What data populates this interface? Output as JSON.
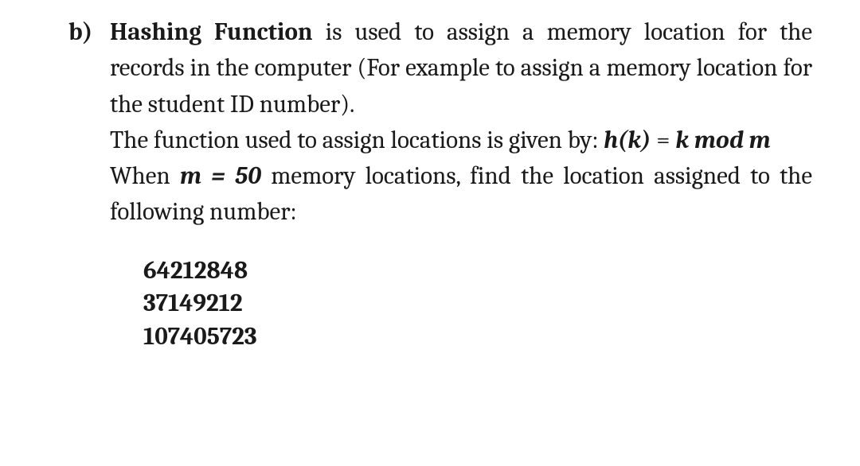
{
  "item_label": "b)",
  "term": "Hashing Function",
  "para1_after_term": " is used to assign a memory location for the records in the computer (For example to assign a memory location for the student ID number).",
  "para2_prefix": "The function used to assign locations is given by: ",
  "formula_hk": "h(k)",
  "formula_eq": " = ",
  "formula_kmodm": "k mod m",
  "para3_prefix": "When  ",
  "m_eq": "m = 50",
  "para3_suffix": "  memory  locations,  find  the  location assigned to the following number:",
  "numbers": {
    "n1": "64212848",
    "n2": "37149212",
    "n3": "107405723"
  }
}
